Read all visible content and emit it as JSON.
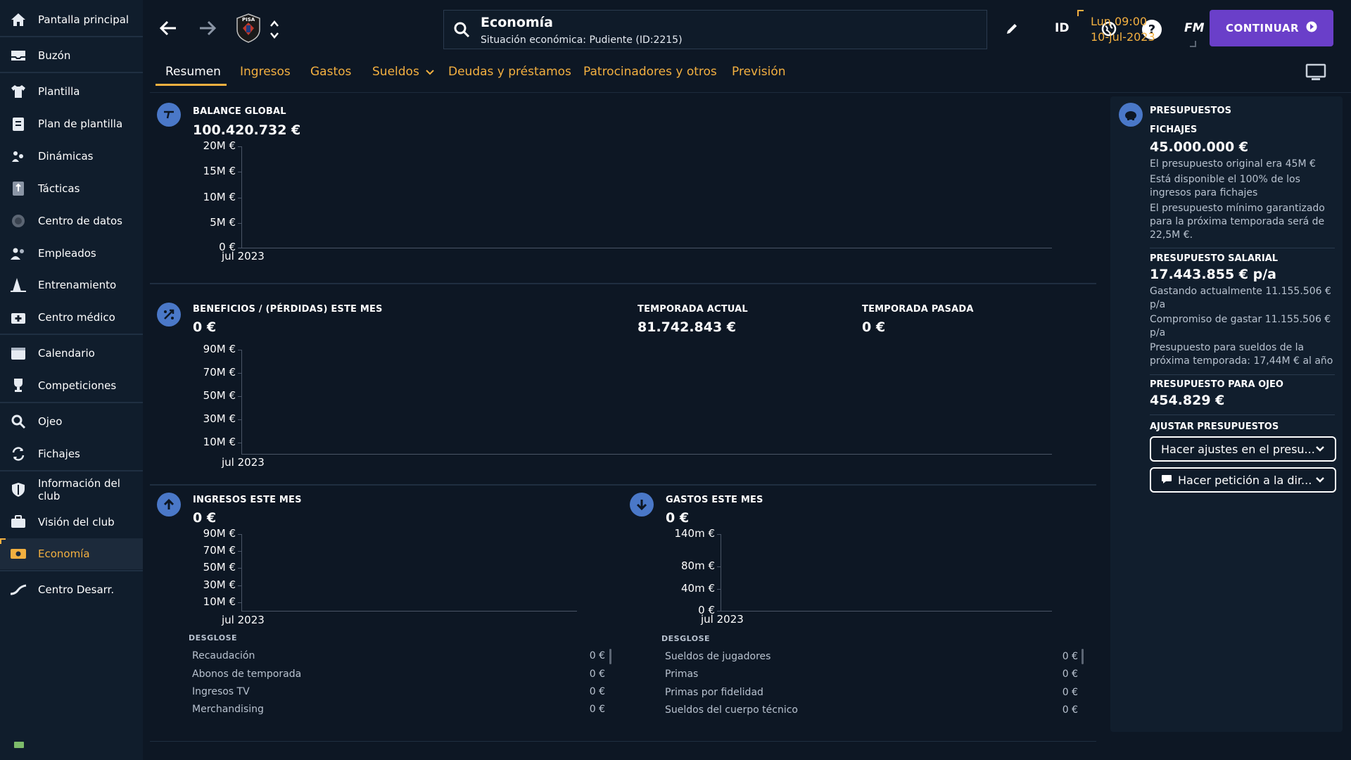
{
  "sidebar": {
    "items": [
      {
        "label": "Pantalla principal",
        "icon": "home-icon"
      },
      {
        "label": "Buzón",
        "icon": "inbox-icon"
      },
      {
        "label": "Plantilla",
        "icon": "shirt-icon"
      },
      {
        "label": "Plan de plantilla",
        "icon": "clipboard-icon"
      },
      {
        "label": "Dinámicas",
        "icon": "people-cycle-icon"
      },
      {
        "label": "Tácticas",
        "icon": "tactics-board-icon"
      },
      {
        "label": "Centro de datos",
        "icon": "data-circle-icon"
      },
      {
        "label": "Empleados",
        "icon": "staff-icon"
      },
      {
        "label": "Entrenamiento",
        "icon": "cone-icon"
      },
      {
        "label": "Centro médico",
        "icon": "medical-kit-icon"
      },
      {
        "label": "Calendario",
        "icon": "calendar-icon"
      },
      {
        "label": "Competiciones",
        "icon": "trophy-icon"
      },
      {
        "label": "Ojeo",
        "icon": "magnifier-icon"
      },
      {
        "label": "Fichajes",
        "icon": "transfer-icon"
      },
      {
        "label": "Información del club",
        "icon": "shield-icon"
      },
      {
        "label": "Visión del club",
        "icon": "briefcase-icon"
      },
      {
        "label": "Economía",
        "icon": "money-icon"
      },
      {
        "label": "Centro Desarr.",
        "icon": "growth-icon"
      }
    ]
  },
  "topbar": {
    "club_badge": "PISA",
    "page_title": "Economía",
    "page_subtitle": "Situación económica: Pudiente (ID:2215)",
    "id_label": "ID",
    "fm_label": "FM",
    "time": "Lun 09:00",
    "date": "10-jul-2023",
    "continue_label": "CONTINUAR"
  },
  "tabs": [
    {
      "label": "Resumen"
    },
    {
      "label": "Ingresos"
    },
    {
      "label": "Gastos"
    },
    {
      "label": "Sueldos"
    },
    {
      "label": "Deudas y préstamos"
    },
    {
      "label": "Patrocinadores y otros"
    },
    {
      "label": "Previsión"
    }
  ],
  "balance": {
    "title": "BALANCE GLOBAL",
    "value": "100.420.732 €"
  },
  "profit": {
    "title": "BENEFICIOS / (PÉRDIDAS) ESTE MES",
    "value": "0 €",
    "current_season_title": "TEMPORADA ACTUAL",
    "current_season_value": "81.742.843 €",
    "last_season_title": "TEMPORADA PASADA",
    "last_season_value": "0 €"
  },
  "income": {
    "title": "INGRESOS ESTE MES",
    "value": "0 €",
    "breakdown_title": "DESGLOSE",
    "rows": [
      {
        "label": "Recaudación",
        "value": "0 €"
      },
      {
        "label": "Abonos de temporada",
        "value": "0 €"
      },
      {
        "label": "Ingresos TV",
        "value": "0 €"
      },
      {
        "label": "Merchandising",
        "value": "0 €"
      }
    ]
  },
  "expenses": {
    "title": "GASTOS ESTE MES",
    "value": "0 €",
    "breakdown_title": "DESGLOSE",
    "rows": [
      {
        "label": "Sueldos de jugadores",
        "value": "0 €"
      },
      {
        "label": "Primas",
        "value": "0 €"
      },
      {
        "label": "Primas por fidelidad",
        "value": "0 €"
      },
      {
        "label": "Sueldos del cuerpo técnico",
        "value": "0 €"
      }
    ]
  },
  "budgets": {
    "title": "PRESUPUESTOS",
    "transfers_title": "FICHAJES",
    "transfers_value": "45.000.000 €",
    "transfers_notes": [
      "El presupuesto original era 45M €",
      "Está disponible el 100% de los ingresos para fichajes",
      "El presupuesto mínimo garantizado para la próxima temporada será de 22,5M €."
    ],
    "wage_title": "PRESUPUESTO SALARIAL",
    "wage_value": "17.443.855 € p/a",
    "wage_notes": [
      "Gastando actualmente 11.155.506 € p/a",
      "Compromiso de gastar 11.155.506 € p/a",
      "Presupuesto para sueldos de la próxima temporada: 17,44M € al año"
    ],
    "scouting_title": "PRESUPUESTO PARA OJEO",
    "scouting_value": "454.829 €",
    "adjust_title": "AJUSTAR PRESUPUESTOS",
    "adjust_dropdown": "Hacer ajustes en el presu...",
    "request_dropdown": "Hacer petición a la dir..."
  },
  "chart_data": [
    {
      "type": "line",
      "title": "BALANCE GLOBAL",
      "x": [
        "jul 2023"
      ],
      "yticks": [
        "20M €",
        "15M €",
        "10M €",
        "5M €",
        "0 €"
      ],
      "ylim": [
        0,
        20000000
      ],
      "series": []
    },
    {
      "type": "bar",
      "title": "BENEFICIOS / (PÉRDIDAS) ESTE MES",
      "x": [
        "jul 2023"
      ],
      "yticks": [
        "90M €",
        "70M €",
        "50M €",
        "30M €",
        "10M €"
      ],
      "ylim": [
        0,
        90000000
      ],
      "series": []
    },
    {
      "type": "bar",
      "title": "INGRESOS ESTE MES",
      "x": [
        "jul 2023"
      ],
      "yticks": [
        "90M €",
        "70M €",
        "50M €",
        "30M €",
        "10M €"
      ],
      "ylim": [
        0,
        90000000
      ],
      "series": []
    },
    {
      "type": "bar",
      "title": "GASTOS ESTE MES",
      "x": [
        "jul 2023"
      ],
      "yticks": [
        "140m €",
        "80m €",
        "40m €",
        "0 €"
      ],
      "ylim": [
        0,
        140
      ],
      "series": []
    }
  ]
}
